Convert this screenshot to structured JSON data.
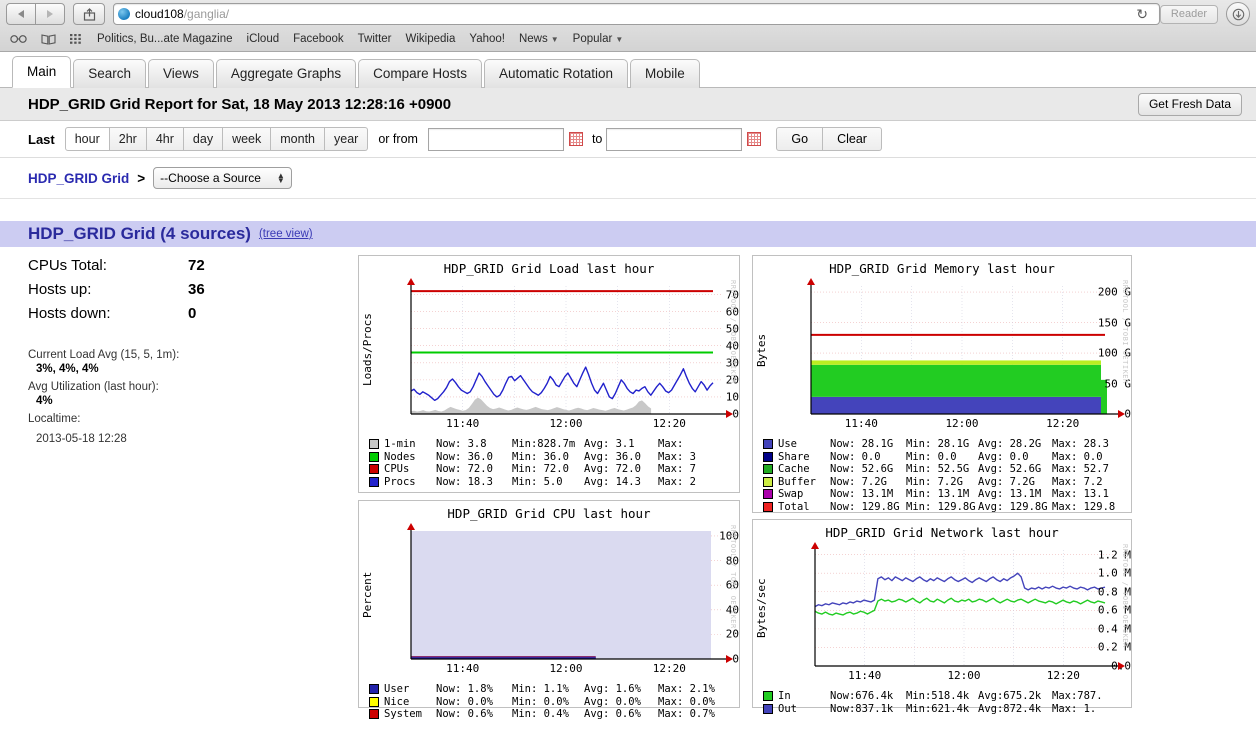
{
  "browser": {
    "url_host": "cloud108",
    "url_path": "/ganglia/",
    "reader_label": "Reader",
    "back_icon": "back-arrow-icon",
    "forward_icon": "forward-arrow-icon",
    "share_icon": "share-icon",
    "reload_icon": "reload-icon",
    "bookmarks": [
      {
        "label": "Politics, Bu...ate Magazine",
        "dropdown": false
      },
      {
        "label": "iCloud",
        "dropdown": false
      },
      {
        "label": "Facebook",
        "dropdown": false
      },
      {
        "label": "Twitter",
        "dropdown": false
      },
      {
        "label": "Wikipedia",
        "dropdown": false
      },
      {
        "label": "Yahoo!",
        "dropdown": false
      },
      {
        "label": "News",
        "dropdown": true
      },
      {
        "label": "Popular",
        "dropdown": true
      }
    ]
  },
  "tabs": [
    {
      "label": "Main",
      "active": true
    },
    {
      "label": "Search",
      "active": false
    },
    {
      "label": "Views",
      "active": false
    },
    {
      "label": "Aggregate Graphs",
      "active": false
    },
    {
      "label": "Compare Hosts",
      "active": false
    },
    {
      "label": "Automatic Rotation",
      "active": false
    },
    {
      "label": "Mobile",
      "active": false
    }
  ],
  "report": {
    "title": "HDP_GRID Grid Report for Sat, 18 May 2013 12:28:16 +0900",
    "fresh_button": "Get Fresh Data"
  },
  "range": {
    "last_label": "Last",
    "buttons": [
      "hour",
      "2hr",
      "4hr",
      "day",
      "week",
      "month",
      "year"
    ],
    "selected": "hour",
    "or_from_label": "or from",
    "from_value": "",
    "to_label": "to",
    "to_value": "",
    "go_label": "Go",
    "clear_label": "Clear"
  },
  "breadcrumb": {
    "grid_link": "HDP_GRID Grid",
    "separator": ">",
    "source_select": "--Choose a Source"
  },
  "grid_header": {
    "title": "HDP_GRID Grid (4 sources)",
    "tree_view": "(tree view)"
  },
  "summary": {
    "rows": [
      {
        "label": "CPUs Total:",
        "value": "72"
      },
      {
        "label": "Hosts up:",
        "value": "36"
      },
      {
        "label": "Hosts down:",
        "value": "0"
      }
    ],
    "load_avg_label": "Current Load Avg (15, 5, 1m):",
    "load_avg_value": "3%, 4%, 4%",
    "utilization_label": "Avg Utilization (last hour):",
    "utilization_value": "4%",
    "localtime_label": "Localtime:",
    "localtime_value": "2013-05-18 12:28"
  },
  "watermark": "RRDTOOL / TOBI OETIKER",
  "chart_data": [
    {
      "type": "line",
      "id": "load",
      "title": "HDP_GRID Grid Load last hour",
      "ylabel": "Loads/Procs",
      "xlabel": "",
      "ylim": [
        0,
        75
      ],
      "yticks": [
        0,
        10,
        20,
        30,
        40,
        50,
        60,
        70
      ],
      "xticks": [
        "11:40",
        "12:00",
        "12:20"
      ],
      "grid": true,
      "series": [
        {
          "name": "1-min",
          "color": "#c8c8c8",
          "style": "area",
          "values": [
            1.0,
            1.2,
            0.9,
            1.1,
            1.4,
            1.0,
            0.9,
            1.2,
            1.5,
            1.1,
            0.9,
            1.3,
            2.0,
            2.6,
            2.2,
            1.8,
            1.5,
            1.2,
            1.4,
            2.2,
            3.6,
            5.2,
            6.0,
            5.4,
            4.2,
            3.0,
            2.2,
            1.8,
            2.0,
            2.4,
            2.0,
            1.6,
            1.3,
            1.5,
            2.0,
            2.4,
            2.0,
            1.7,
            1.5,
            1.8,
            2.2,
            2.6,
            2.2,
            1.8,
            1.6,
            1.4,
            1.7,
            2.1,
            2.5,
            2.2,
            1.8,
            1.5,
            1.3,
            1.6,
            2.0,
            2.3,
            2.0,
            1.6,
            1.4,
            1.8,
            2.2,
            1.9,
            1.6,
            1.4,
            1.2,
            1.5,
            1.9,
            2.2,
            1.8,
            1.5,
            1.3,
            1.6,
            2.0,
            2.4,
            3.2,
            4.6,
            5.0,
            4.0,
            2.8,
            2.0
          ]
        },
        {
          "name": "Nodes",
          "color": "#00cc00",
          "style": "line",
          "value": 36.0
        },
        {
          "name": "CPUs",
          "color": "#cc0000",
          "style": "line",
          "value": 72.0
        },
        {
          "name": "Procs",
          "color": "#2222cc",
          "style": "line",
          "values": [
            13.5,
            14.5,
            12.5,
            11.5,
            13.0,
            12.0,
            11.0,
            9.5,
            8.0,
            9.0,
            11.0,
            13.0,
            15.5,
            19.0,
            20.5,
            18.5,
            16.0,
            14.0,
            13.0,
            12.0,
            13.0,
            16.0,
            20.0,
            24.0,
            22.0,
            19.0,
            16.5,
            14.0,
            11.5,
            10.0,
            11.0,
            14.0,
            18.0,
            21.5,
            22.0,
            19.5,
            21.0,
            22.5,
            20.0,
            17.5,
            15.0,
            13.0,
            12.0,
            11.0,
            12.5,
            15.0,
            18.0,
            22.0,
            20.0,
            17.0,
            16.0,
            19.0,
            22.0,
            24.0,
            21.0,
            18.0,
            16.0,
            20.0,
            24.0,
            27.5,
            23.0,
            18.0,
            14.0,
            12.0,
            15.0,
            18.0,
            14.0,
            10.0,
            9.0,
            12.0,
            16.0,
            20.0,
            18.0,
            15.0,
            13.0,
            12.0,
            14.0,
            13.5,
            15.0,
            16.0,
            13.0,
            11.0,
            13.5,
            16.0,
            18.0,
            16.0,
            13.5,
            12.5,
            14.0,
            17.0,
            20.0,
            23.0,
            26.5,
            22.0,
            18.0,
            15.0,
            13.0,
            16.0,
            19.0,
            17.0,
            14.0,
            16.5,
            18.3
          ]
        }
      ],
      "legend": [
        {
          "name": "1-min",
          "color": "#c8c8c8",
          "now": "Now:    3.8",
          "min": "Min:828.7m",
          "avg": "Avg:    3.1",
          "max": "Max:"
        },
        {
          "name": "Nodes",
          "color": "#00cc00",
          "now": "Now:   36.0",
          "min": "Min:   36.0",
          "avg": "Avg:   36.0",
          "max": "Max:  3"
        },
        {
          "name": "CPUs",
          "color": "#cc0000",
          "now": "Now:   72.0",
          "min": "Min:   72.0",
          "avg": "Avg:   72.0",
          "max": "Max:  7"
        },
        {
          "name": "Procs",
          "color": "#2222cc",
          "now": "Now:   18.3",
          "min": "Min:    5.0",
          "avg": "Avg:   14.3",
          "max": "Max:  2"
        }
      ]
    },
    {
      "type": "area",
      "id": "memory",
      "title": "HDP_GRID Grid Memory last hour",
      "ylabel": "Bytes",
      "ylim": [
        0,
        210
      ],
      "yticks": [
        "0",
        "50 G",
        "100 G",
        "150 G",
        "200 G"
      ],
      "ytick_values": [
        0,
        50,
        100,
        150,
        200
      ],
      "xticks": [
        "11:40",
        "12:00",
        "12:20"
      ],
      "grid": true,
      "stack": [
        {
          "name": "Use",
          "color": "#4444bb",
          "value": 28.1
        },
        {
          "name": "Cache",
          "color": "#22cc22",
          "value": 52.6
        },
        {
          "name": "Buffer",
          "color": "#bbee22",
          "value": 7.2
        }
      ],
      "total_line": {
        "name": "Total",
        "color": "#cc0000",
        "value": 129.8
      },
      "legend": [
        {
          "name": "Use",
          "color": "#4444bb",
          "now": "Now:   28.1G",
          "min": "Min:   28.1G",
          "avg": "Avg:   28.2G",
          "max": "Max:   28.3"
        },
        {
          "name": "Share",
          "color": "#000088",
          "now": "Now:    0.0",
          "min": "Min:    0.0",
          "avg": "Avg:    0.0",
          "max": "Max:    0.0"
        },
        {
          "name": "Cache",
          "color": "#22aa22",
          "now": "Now:   52.6G",
          "min": "Min:   52.5G",
          "avg": "Avg:   52.6G",
          "max": "Max:   52.7"
        },
        {
          "name": "Buffer",
          "color": "#cced44",
          "now": "Now:    7.2G",
          "min": "Min:    7.2G",
          "avg": "Avg:    7.2G",
          "max": "Max:    7.2"
        },
        {
          "name": "Swap",
          "color": "#aa00aa",
          "now": "Now:   13.1M",
          "min": "Min:   13.1M",
          "avg": "Avg:   13.1M",
          "max": "Max:   13.1"
        },
        {
          "name": "Total",
          "color": "#ee2222",
          "now": "Now:  129.8G",
          "min": "Min:  129.8G",
          "avg": "Avg:  129.8G",
          "max": "Max:  129.8"
        }
      ]
    },
    {
      "type": "area",
      "id": "cpu",
      "title": "HDP_GRID Grid CPU last hour",
      "ylabel": "Percent",
      "ylim": [
        0,
        104
      ],
      "yticks": [
        0,
        20,
        40,
        60,
        80,
        100
      ],
      "xticks": [
        "11:40",
        "12:00",
        "12:20"
      ],
      "grid": true,
      "idle_color": "#dadaf0",
      "series": [
        {
          "name": "User",
          "color": "#2222aa",
          "now": 1.8,
          "min": 1.1,
          "avg": 1.6,
          "max": 2.1
        },
        {
          "name": "Nice",
          "color": "#ffff00",
          "now": 0.0,
          "min": 0.0,
          "avg": 0.0,
          "max": 0.0
        },
        {
          "name": "System",
          "color": "#cc0000",
          "now": 0.6,
          "min": 0.4,
          "avg": 0.6,
          "max": 0.7
        }
      ],
      "legend": [
        {
          "name": "User",
          "color": "#2222aa",
          "now": "Now:    1.8%",
          "min": "Min:    1.1%",
          "avg": "Avg:    1.6%",
          "max": "Max:    2.1%"
        },
        {
          "name": "Nice",
          "color": "#ffff00",
          "now": "Now:    0.0%",
          "min": "Min:    0.0%",
          "avg": "Avg:    0.0%",
          "max": "Max:    0.0%"
        },
        {
          "name": "System",
          "color": "#cc0000",
          "now": "Now:    0.6%",
          "min": "Min:    0.4%",
          "avg": "Avg:    0.6%",
          "max": "Max:    0.7%"
        }
      ]
    },
    {
      "type": "line",
      "id": "network",
      "title": "HDP_GRID Grid Network last hour",
      "ylabel": "Bytes/sec",
      "ylim": [
        0,
        1.25
      ],
      "yticks": [
        "0.0",
        "0.2 M",
        "0.4 M",
        "0.6 M",
        "0.8 M",
        "1.0 M",
        "1.2 M"
      ],
      "ytick_values": [
        0,
        0.2,
        0.4,
        0.6,
        0.8,
        1.0,
        1.2
      ],
      "xticks": [
        "11:40",
        "12:00",
        "12:20"
      ],
      "grid": true,
      "series": [
        {
          "name": "In",
          "color": "#22cc22",
          "values": [
            0.59,
            0.57,
            0.56,
            0.58,
            0.56,
            0.55,
            0.57,
            0.56,
            0.55,
            0.57,
            0.58,
            0.56,
            0.57,
            0.59,
            0.58,
            0.56,
            0.58,
            0.6,
            0.7,
            0.72,
            0.7,
            0.71,
            0.69,
            0.7,
            0.72,
            0.71,
            0.69,
            0.71,
            0.73,
            0.7,
            0.68,
            0.71,
            0.73,
            0.7,
            0.69,
            0.72,
            0.7,
            0.68,
            0.71,
            0.73,
            0.7,
            0.69,
            0.71,
            0.7,
            0.72,
            0.69,
            0.7,
            0.72,
            0.71,
            0.69,
            0.71,
            0.73,
            0.7,
            0.68,
            0.7,
            0.72,
            0.7,
            0.69,
            0.71,
            0.72,
            0.7,
            0.68,
            0.7,
            0.72,
            0.7,
            0.69,
            0.68,
            0.7,
            0.69,
            0.67,
            0.69,
            0.71,
            0.69,
            0.68,
            0.7,
            0.69,
            0.67,
            0.69,
            0.71,
            0.69,
            0.68,
            0.7,
            0.69,
            0.68
          ]
        },
        {
          "name": "Out",
          "color": "#4444bb",
          "values": [
            0.64,
            0.66,
            0.65,
            0.67,
            0.66,
            0.68,
            0.67,
            0.66,
            0.68,
            0.67,
            0.69,
            0.68,
            0.7,
            0.69,
            0.71,
            0.7,
            0.69,
            0.71,
            0.94,
            0.96,
            0.93,
            0.95,
            0.92,
            0.96,
            0.94,
            0.92,
            0.95,
            0.93,
            0.91,
            0.94,
            0.96,
            0.93,
            0.91,
            0.94,
            0.92,
            0.95,
            0.93,
            0.91,
            0.94,
            0.96,
            0.93,
            0.91,
            0.93,
            0.95,
            0.92,
            0.9,
            0.93,
            0.95,
            0.93,
            0.91,
            0.94,
            0.96,
            0.93,
            0.91,
            0.94,
            0.92,
            0.95,
            0.97,
            1.0,
            0.96,
            0.84,
            0.82,
            0.84,
            0.83,
            0.85,
            0.83,
            0.85,
            0.84,
            0.86,
            0.84,
            0.83,
            0.85,
            0.84,
            0.86,
            0.84,
            0.83,
            0.85,
            0.84,
            0.82,
            0.84,
            0.85,
            0.83,
            0.84,
            0.85
          ]
        }
      ],
      "legend": [
        {
          "name": "In",
          "color": "#22cc22",
          "now": "Now:676.4k",
          "min": "Min:518.4k",
          "avg": "Avg:675.2k",
          "max": "Max:787."
        },
        {
          "name": "Out",
          "color": "#4444bb",
          "now": "Now:837.1k",
          "min": "Min:621.4k",
          "avg": "Avg:872.4k",
          "max": "Max:   1."
        }
      ]
    }
  ]
}
